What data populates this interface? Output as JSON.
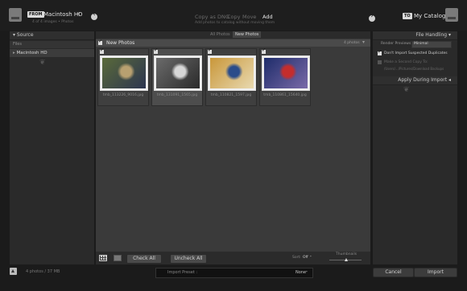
{
  "header": {
    "source_tag": "FROM",
    "source_name": "Macintosh HD",
    "source_sub": "4 of 4 images • Photos",
    "modes": [
      "Copy as DNG",
      "Copy",
      "Move",
      "Add"
    ],
    "active_mode": "Add",
    "mode_desc": "Add photos to catalog without moving them",
    "dest_tag": "TO",
    "dest_name": "My Catalog"
  },
  "left_panel": {
    "title": "Source",
    "files_label": "Files",
    "drive_label": "Macintosh HD"
  },
  "center": {
    "filter_tabs": [
      "All Photos",
      "New Photos"
    ],
    "group_title": "New Photos",
    "group_count": "4 photos",
    "thumbnails": [
      {
        "name": "tmb_113226_9016.jpg",
        "checked": true,
        "colors": [
          "#5a6a3a",
          "#b8a070",
          "#2c3550"
        ]
      },
      {
        "name": "tmb_131091_1565.jpg",
        "checked": true,
        "colors": [
          "#6b6b6b",
          "#d7d7d7",
          "#2a2a2a"
        ]
      },
      {
        "name": "tmb_110821_1597.jpg",
        "checked": true,
        "colors": [
          "#c9973a",
          "#2a4c8a",
          "#e8d9b0"
        ]
      },
      {
        "name": "tmb_110861_15640.jpg",
        "checked": true,
        "colors": [
          "#1e2c6a",
          "#c42d2d",
          "#7a6aa8"
        ]
      }
    ],
    "check_all": "Check All",
    "uncheck_all": "Uncheck All",
    "sort_label": "Sort:",
    "sort_value": "Off",
    "thumbnails_label": "Thumbnails"
  },
  "right_panel": {
    "file_handling_title": "File Handling",
    "render_label": "Render Previews",
    "render_value": "Minimal",
    "dont_import_label": "Don't Import Suspected Duplicates",
    "second_copy_label": "Make a Second Copy To:",
    "second_copy_path": "/Users/.../Pictures/Download Backups",
    "apply_title": "Apply During Import"
  },
  "footer": {
    "status": "4 photos / 37 MB",
    "preset_label": "Import Preset :",
    "preset_value": "None",
    "cancel": "Cancel",
    "import": "Import"
  }
}
